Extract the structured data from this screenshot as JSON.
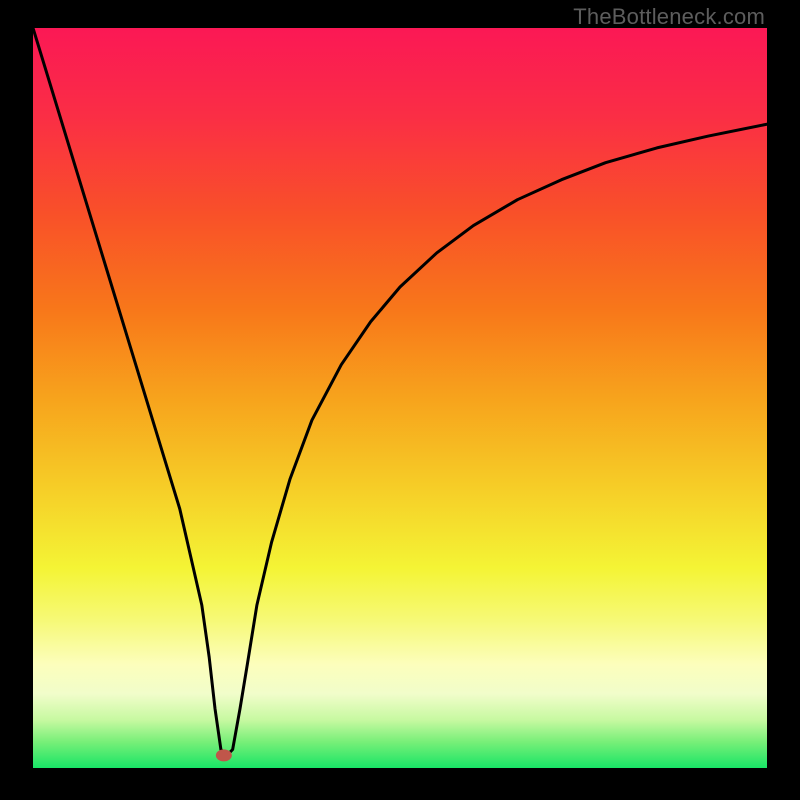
{
  "watermark": "TheBottleneck.com",
  "chart_data": {
    "type": "line",
    "title": "",
    "xlabel": "",
    "ylabel": "",
    "xlim": [
      0,
      100
    ],
    "ylim": [
      0,
      100
    ],
    "grid": false,
    "series": [
      {
        "name": "curve",
        "x": [
          0,
          2,
          4,
          6,
          8,
          10,
          12,
          14,
          16,
          18,
          20,
          21.5,
          23,
          24,
          24.8,
          25.6,
          26.4,
          27.2,
          28.2,
          29.2,
          30.5,
          32.5,
          35,
          38,
          42,
          46,
          50,
          55,
          60,
          66,
          72,
          78,
          85,
          92,
          100
        ],
        "y": [
          100,
          93.5,
          87,
          80.5,
          74,
          67.5,
          61,
          54.5,
          48,
          41.5,
          35,
          28.5,
          22,
          15,
          8,
          2.5,
          1.7,
          2.5,
          8,
          14,
          22,
          30.5,
          39,
          47,
          54.5,
          60.3,
          65,
          69.6,
          73.3,
          76.8,
          79.5,
          81.8,
          83.8,
          85.4,
          87
        ]
      }
    ],
    "marker": {
      "name": "bottleneck-point",
      "x": 26,
      "y": 1.7,
      "color": "#c0564a"
    },
    "background": {
      "type": "vertical-gradient",
      "stops": [
        {
          "pos": 0.0,
          "color": "#fb1855"
        },
        {
          "pos": 0.12,
          "color": "#fa2e45"
        },
        {
          "pos": 0.25,
          "color": "#f95029"
        },
        {
          "pos": 0.38,
          "color": "#f8771a"
        },
        {
          "pos": 0.5,
          "color": "#f7a31c"
        },
        {
          "pos": 0.62,
          "color": "#f6cd27"
        },
        {
          "pos": 0.73,
          "color": "#f4f435"
        },
        {
          "pos": 0.8,
          "color": "#f6f976"
        },
        {
          "pos": 0.86,
          "color": "#fcfebc"
        },
        {
          "pos": 0.9,
          "color": "#f1fdca"
        },
        {
          "pos": 0.935,
          "color": "#c7f9a1"
        },
        {
          "pos": 0.965,
          "color": "#77ef78"
        },
        {
          "pos": 1.0,
          "color": "#18e566"
        }
      ]
    }
  }
}
